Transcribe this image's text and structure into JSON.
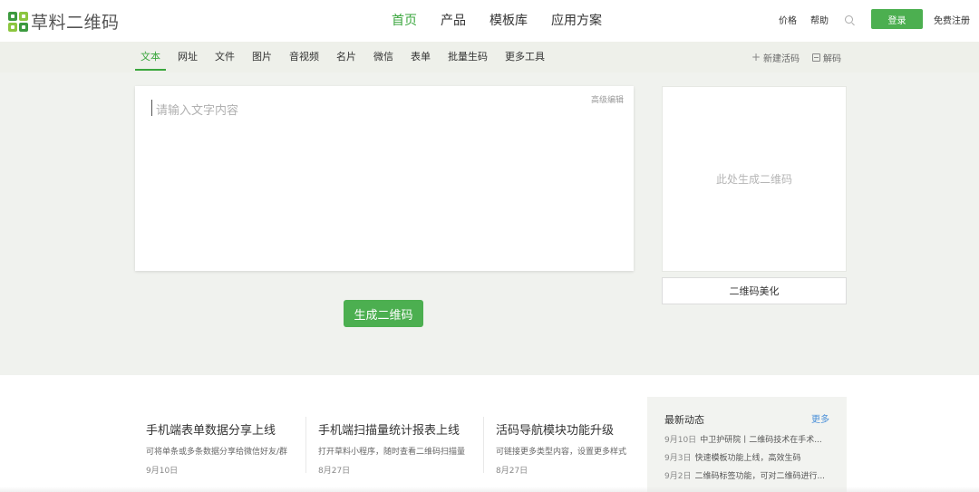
{
  "brand": {
    "name": "草料二维码"
  },
  "nav": {
    "items": [
      "首页",
      "产品",
      "模板库",
      "应用方案"
    ],
    "active": 0
  },
  "top_links": {
    "price": "价格",
    "help": "帮助",
    "login": "登录",
    "register": "免费注册"
  },
  "tabs": {
    "items": [
      "文本",
      "网址",
      "文件",
      "图片",
      "音视频",
      "名片",
      "微信",
      "表单",
      "批量生码",
      "更多工具"
    ],
    "active": 0
  },
  "sub_actions": {
    "new_code": "新建活码",
    "decode": "解码"
  },
  "editor": {
    "placeholder": "请输入文字内容",
    "advanced": "高级编辑",
    "generate": "生成二维码"
  },
  "preview": {
    "placeholder": "此处生成二维码",
    "beautify": "二维码美化"
  },
  "features": [
    {
      "title": "手机端表单数据分享上线",
      "desc": "可将单条或多条数据分享给微信好友/群",
      "date": "9月10日"
    },
    {
      "title": "手机端扫描量统计报表上线",
      "desc": "打开草料小程序，随时查看二维码扫描量",
      "date": "8月27日"
    },
    {
      "title": "活码导航模块功能升级",
      "desc": "可链接更多类型内容，设置更多样式",
      "date": "8月27日"
    }
  ],
  "updates": {
    "title": "最新动态",
    "more": "更多",
    "items": [
      {
        "date": "9月10日",
        "text": "中卫护研院丨二维码技术在手术..."
      },
      {
        "date": "9月3日",
        "text": "快速模板功能上线，高效生码"
      },
      {
        "date": "9月2日",
        "text": "二维码标签功能，可对二维码进行..."
      }
    ]
  },
  "colors": {
    "accent": "#4caf50",
    "active_text": "#3aa63d",
    "link": "#4a8fd8",
    "bg_band": "#f0f2ee"
  }
}
